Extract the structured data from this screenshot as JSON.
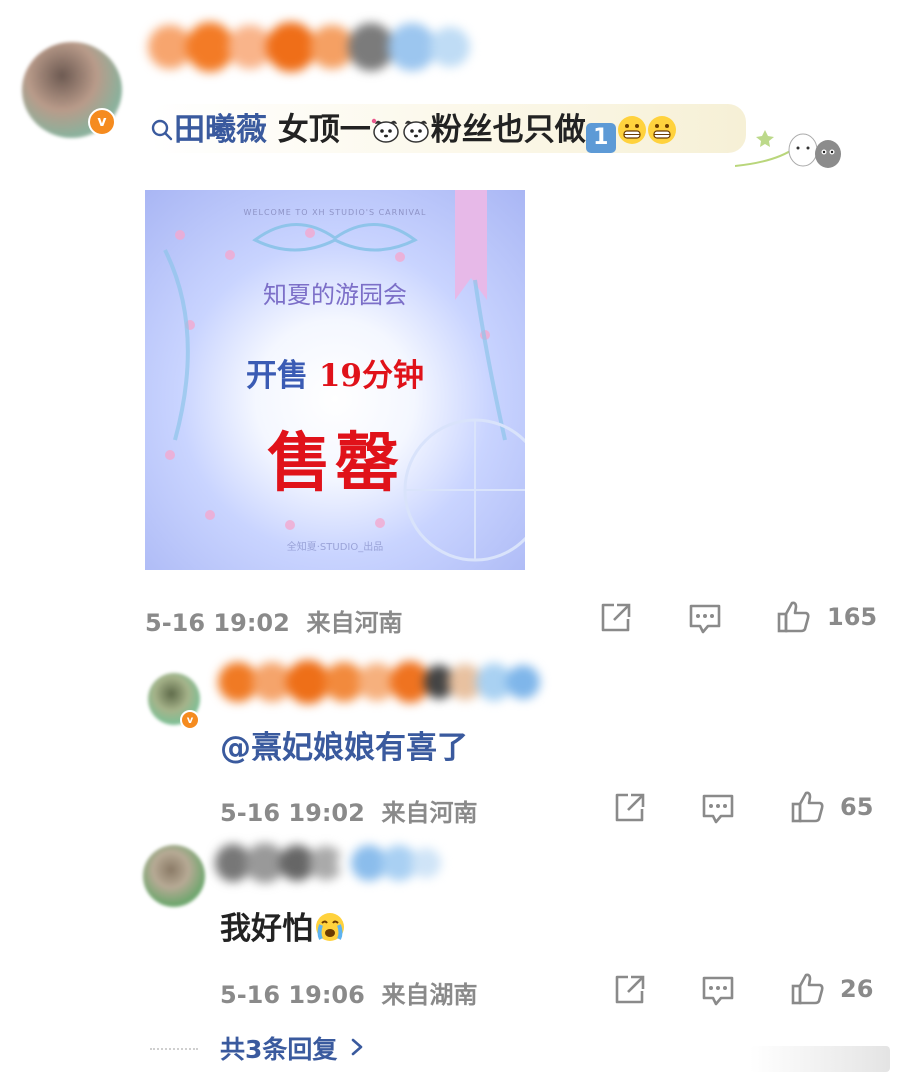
{
  "main_comment": {
    "search_icon": "search-icon",
    "topic_link": "田曦薇",
    "text": "女顶一",
    "text_after_emoji": "粉丝也只做",
    "number_emoji": "1",
    "promo_image": {
      "top_small": "WELCOME TO XH STUDIO'S CARNIVAL",
      "title": "知夏的游园会",
      "line1_prefix": "开售",
      "line1_highlight": "19分钟",
      "line2": "售罄",
      "footer": "全知夏·STUDIO_出品"
    },
    "timestamp": "5-16 19:02",
    "location": "来自河南",
    "likes": "165"
  },
  "replies": [
    {
      "text": "@熹妃娘娘有喜了",
      "timestamp": "5-16 19:02",
      "location": "来自河南",
      "likes": "65"
    },
    {
      "text": "我好怕",
      "timestamp": "5-16 19:06",
      "location": "来自湖南",
      "likes": "26"
    }
  ],
  "more_replies": {
    "label": "共3条回复"
  },
  "colors": {
    "link": "#3a5a9e",
    "meta": "#8a8a8a",
    "badge": "#f58b1f"
  }
}
